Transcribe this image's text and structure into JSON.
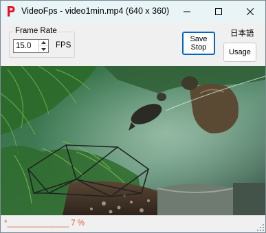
{
  "window": {
    "title": "VideoFps - video1min.mp4 (640 x 360)",
    "icon": "P",
    "accent": "#e81123"
  },
  "frame_rate": {
    "legend": "Frame Rate",
    "value": "15.0",
    "unit": "FPS"
  },
  "buttons": {
    "save_line1": "Save",
    "save_line2": "Stop",
    "usage": "Usage",
    "language": "日本語"
  },
  "status": {
    "text": "*______________ 7 %",
    "progress_percent": 7,
    "color": "#e05a3a"
  }
}
